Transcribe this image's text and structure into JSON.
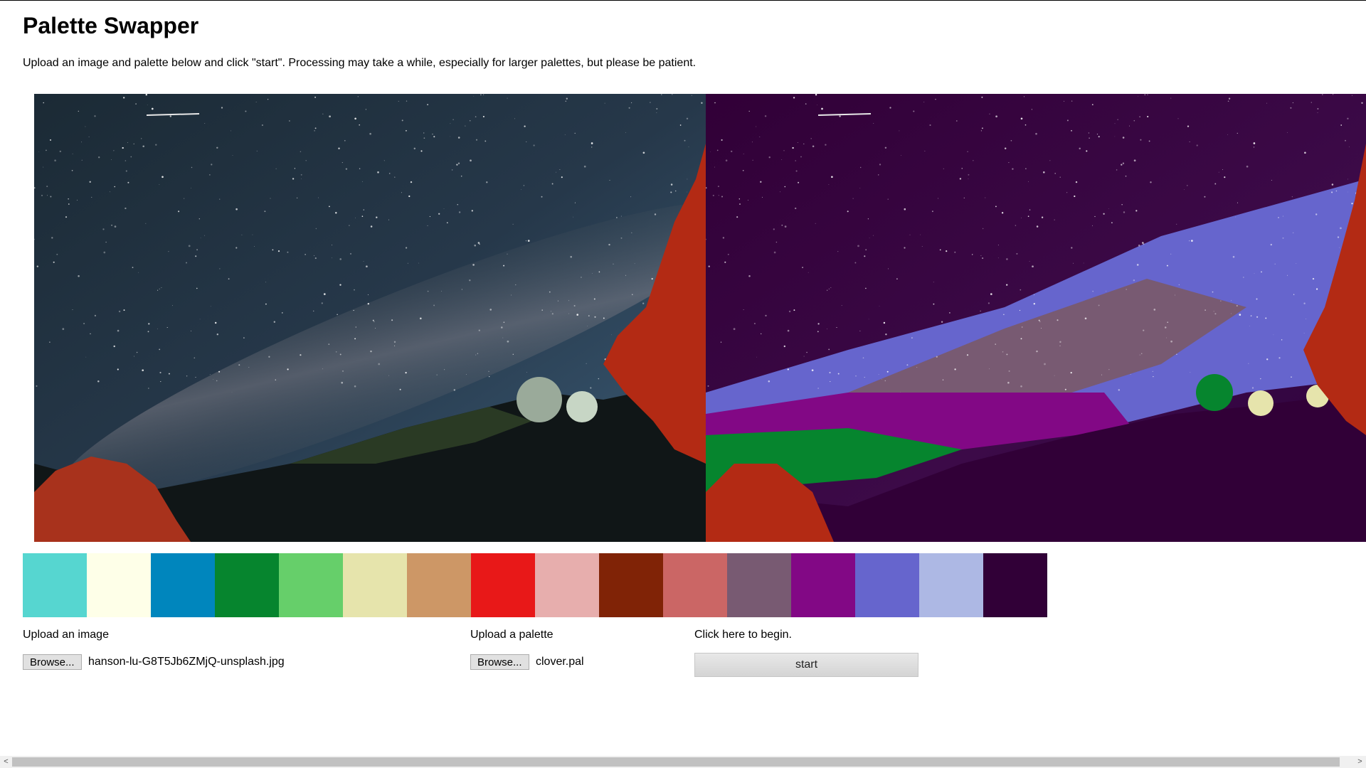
{
  "page": {
    "title": "Palette Swapper",
    "intro": "Upload an image and palette below and click \"start\". Processing may take a while, especially for larger palettes, but please be patient."
  },
  "images": {
    "original_desc": "original-image",
    "swapped_desc": "palette-swapped-image"
  },
  "palette": {
    "colors": [
      "#56d6d0",
      "#feffe8",
      "#0086bd",
      "#06852e",
      "#66cf6a",
      "#e6e4ac",
      "#cd9766",
      "#e81818",
      "#e7aead",
      "#802306",
      "#cb6665",
      "#785a72",
      "#820885",
      "#6665cd",
      "#adb8e4",
      "#310037"
    ]
  },
  "upload_image": {
    "label": "Upload an image",
    "button": "Browse...",
    "filename": "hanson-lu-G8T5Jb6ZMjQ-unsplash.jpg"
  },
  "upload_palette": {
    "label": "Upload a palette",
    "button": "Browse...",
    "filename": "clover.pal"
  },
  "start": {
    "label": "Click here to begin.",
    "button": "start"
  },
  "scrollbar": {
    "left_arrow": "<",
    "right_arrow": ">"
  }
}
